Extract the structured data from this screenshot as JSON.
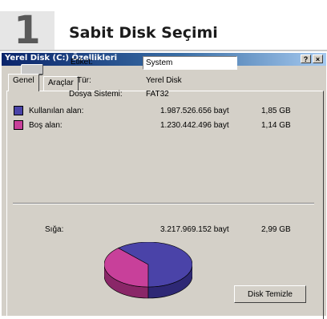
{
  "header": {
    "step_number": "1",
    "title": "Sabit Disk Seçimi"
  },
  "window": {
    "title": "Yerel Disk (C:) Özellikleri",
    "help_button": "?",
    "close_button": "×"
  },
  "tabs": [
    {
      "label": "Genel",
      "active": true
    },
    {
      "label": "Araçlar",
      "active": false
    }
  ],
  "general": {
    "label_field": {
      "label": "Etiket:",
      "value": "System"
    },
    "type": {
      "label": "Tür:",
      "value": "Yerel Disk"
    },
    "file_system": {
      "label": "Dosya Sistemi:",
      "value": "FAT32"
    },
    "used": {
      "label": "Kullanılan alan:",
      "bytes": "1.987.526.656 bayt",
      "size": "1,85 GB",
      "color": "#4a43a8",
      "value_gb": 1.85
    },
    "free": {
      "label": "Boş alan:",
      "bytes": "1.230.442.496 bayt",
      "size": "1,14 GB",
      "color": "#c8409a",
      "value_gb": 1.14
    },
    "capacity": {
      "label": "Sığa:",
      "bytes": "3.217.969.152 bayt",
      "size": "2,99 GB"
    }
  },
  "buttons": {
    "disk_cleanup": "Disk Temizle"
  }
}
